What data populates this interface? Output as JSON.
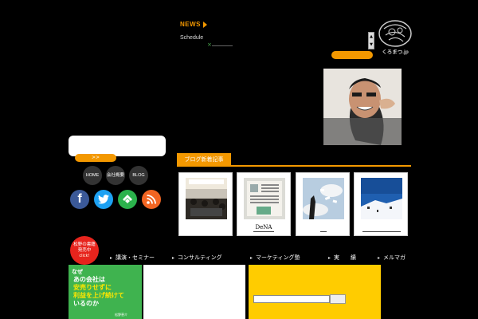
{
  "news": {
    "title": "NEWS",
    "items": [
      {
        "label": "Schedule",
        "mark": "×"
      }
    ]
  },
  "logo": {
    "text": "くろまつ.jp"
  },
  "scroll": {
    "up": "▲",
    "down": "▼"
  },
  "sidebar": {
    "search_button": ">>",
    "nav": [
      {
        "label": "HOME"
      },
      {
        "label": "会社概要"
      },
      {
        "label": "BLOG"
      }
    ],
    "social": [
      {
        "icon": "facebook-icon",
        "glyph": "f",
        "color": "#3b5998"
      },
      {
        "icon": "twitter-icon",
        "glyph": "t",
        "color": "#1da1f2"
      },
      {
        "icon": "feedly-icon",
        "glyph": "f",
        "color": "#2bb24c"
      },
      {
        "icon": "rss-icon",
        "glyph": "rss",
        "color": "#f26522"
      }
    ]
  },
  "blog": {
    "header": "ブログ新着記事",
    "cards": [
      {
        "caption": "",
        "thumb": "banquet"
      },
      {
        "caption": "DeNA",
        "thumb": "newspaper"
      },
      {
        "caption": "",
        "thumb": "sky-money"
      },
      {
        "caption": "",
        "thumb": "ski"
      }
    ]
  },
  "menu": [
    {
      "label": "講演・セミナー"
    },
    {
      "label": "コンサルティング"
    },
    {
      "label": "マーケティング塾"
    },
    {
      "label": "実　　績"
    },
    {
      "label": "メルマガ"
    }
  ],
  "book_ad": {
    "badge_line1": "松野の書籍",
    "badge_line2": "発売中",
    "badge_click": "click!",
    "naze": "なぜ",
    "title_line1": "あの会社は",
    "title_line2": "安売りせずに",
    "title_line3": "利益を上げ続けて",
    "title_line4": "いるのか",
    "publisher": "松野恵介"
  },
  "colors": {
    "accent": "#f39800",
    "background": "#000000",
    "panel_yellow": "#ffcc00"
  }
}
